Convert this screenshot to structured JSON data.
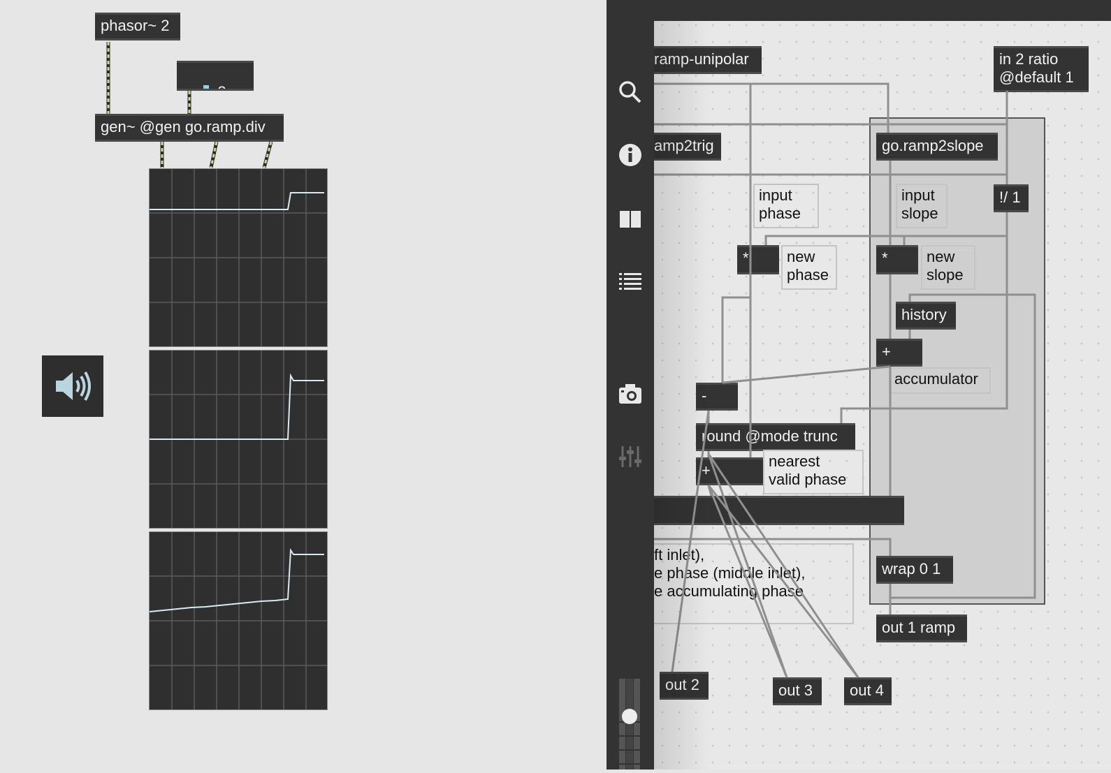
{
  "left_patch": {
    "phasor_label": "phasor~ 2",
    "number_value": "3.",
    "gen_label": "gen~ @gen go.ramp.div"
  },
  "right_patch": {
    "ramp_unipolar": "ramp-unipolar",
    "ramp2trig": "amp2trig",
    "in2": "in 2 ratio\n@default 1",
    "go_ramp2slope": "go.ramp2slope",
    "input_phase": "input\nphase",
    "input_slope": "input\nslope",
    "div": "!/ 1",
    "mul_a": "*",
    "mul_b": "*",
    "new_phase": "new\nphase",
    "new_slope": "new\nslope",
    "history": "history",
    "plus_a": "+",
    "accumulator": "accumulator",
    "minus": "-",
    "round": "round @mode trunc",
    "plus_b": "+",
    "nearest": "nearest\nvalid phase",
    "wrap": "wrap 0 1",
    "comment_lines": "ft inlet),\ne phase (middle inlet),\ne accumulating phase",
    "out1": "out 1 ramp",
    "out2": "out 2",
    "out3": "out 3",
    "out4": "out 4"
  },
  "toolbar_icons": [
    "search-icon",
    "info-icon",
    "columns-icon",
    "list-icon",
    "camera-icon",
    "mixer-icon"
  ],
  "colors": {
    "object_bg": "#333333",
    "signal_patch_cord": "#c8de8c",
    "scope_line": "#d6ecf0"
  }
}
